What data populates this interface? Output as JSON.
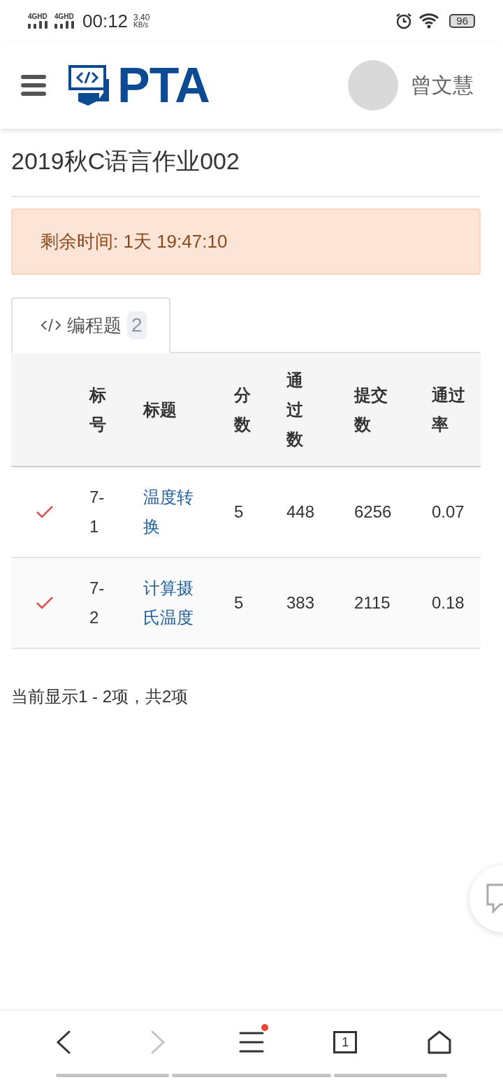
{
  "status_bar": {
    "signals": [
      "4GHD",
      "4GHD"
    ],
    "time": "00:12",
    "speed": "3.40",
    "speed_unit": "KB/s",
    "battery": "96"
  },
  "header": {
    "logo_text": "PTA",
    "user_name": "曾文慧"
  },
  "title": "2019秋C语言作业002",
  "countdown": "剩余时间: 1天 19:47:10",
  "tabs": [
    {
      "label": "编程题",
      "count": "2",
      "selected": true
    }
  ],
  "table": {
    "columns": [
      "标号",
      "标题",
      "分数",
      "通过数",
      "提交数",
      "通过率"
    ],
    "rows": [
      {
        "solved": true,
        "number": "7-1",
        "title": "温度转换",
        "score": "5",
        "passed": "448",
        "submitted": "6256",
        "rate": "0.07"
      },
      {
        "solved": true,
        "number": "7-2",
        "title": "计算摄氏温度",
        "score": "5",
        "passed": "383",
        "submitted": "2115",
        "rate": "0.18"
      }
    ]
  },
  "pagination": "当前显示1 - 2项，共2项",
  "browser_bar": {
    "back_disabled": false,
    "forward_disabled": true,
    "menu_notification": true,
    "tab_count": "1"
  }
}
